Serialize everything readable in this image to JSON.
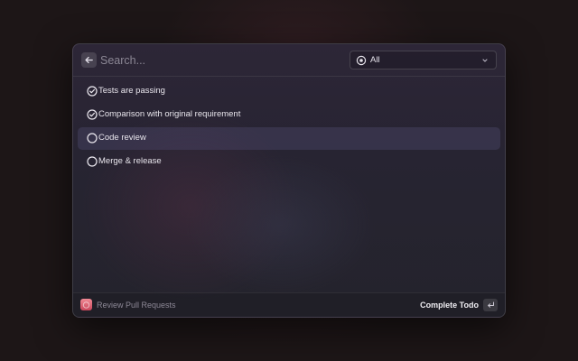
{
  "search": {
    "placeholder": "Search..."
  },
  "filter": {
    "selected": "All",
    "icon": "target-icon"
  },
  "items": [
    {
      "label": "Tests are passing",
      "done": true
    },
    {
      "label": "Comparison with original requirement",
      "done": true
    },
    {
      "label": "Code review",
      "done": false,
      "selected": true
    },
    {
      "label": "Merge & release",
      "done": false
    }
  ],
  "footer": {
    "app_name": "Review Pull Requests",
    "action_label": "Complete Todo",
    "action_key_icon": "enter-key-icon"
  },
  "colors": {
    "selection": "#3a3a55",
    "app_icon": "#e06a78"
  }
}
